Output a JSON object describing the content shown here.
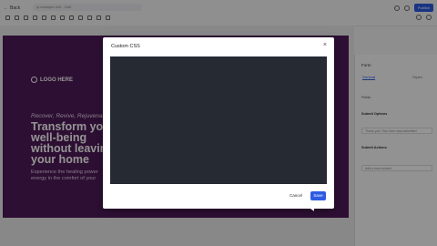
{
  "topbar": {
    "back_label": "Back",
    "url_text": "lp.example.net/.../edit",
    "publish_label": "Publish"
  },
  "hero": {
    "logo_text": "LOGO HERE",
    "tagline": "Recover, Revive, Rejuvenate",
    "headline_lines": [
      "Transform you",
      "well-being",
      "without leavin",
      "your home"
    ],
    "desc_lines": [
      "Experience the healing power",
      "energy in the comfort of your"
    ]
  },
  "panel": {
    "title": "Form",
    "tab_general": "General",
    "tab_styles": "Styles",
    "section1": "Fields",
    "section2": "Submit Options",
    "field2": "Thank you! Your form was submitted",
    "section3": "Submit Actions",
    "field3": "Add a new contact"
  },
  "modal": {
    "title": "Custom CSS",
    "close_glyph": "×",
    "cancel_label": "Cancel",
    "save_label": "Save"
  }
}
